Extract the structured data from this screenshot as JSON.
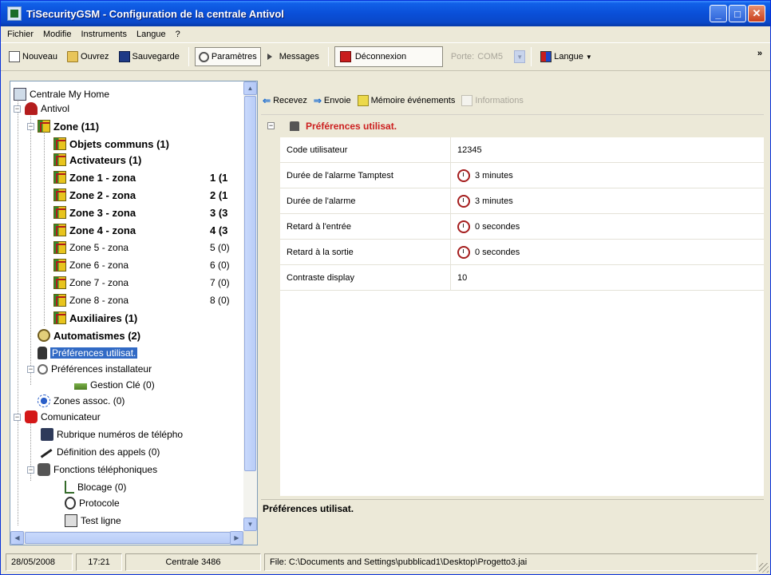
{
  "window": {
    "title": "TiSecurityGSM - Configuration de la centrale Antivol",
    "buttons": {
      "minimize": "_",
      "maximize": "□",
      "close": "✕"
    }
  },
  "menu": [
    "Fichier",
    "Modifie",
    "Instruments",
    "Langue",
    "?"
  ],
  "toolbar": {
    "new_label": "Nouveau",
    "open_label": "Ouvrez",
    "save_label": "Sauvegarde",
    "params_label": "Paramètres",
    "messages_label": "Messages",
    "disconnect_label": "Déconnexion",
    "port_label": "Porte:",
    "port_value": "COM5",
    "language_label": "Langue",
    "more_glyph": "»"
  },
  "tree": {
    "items": [
      {
        "label": "Centrale My Home"
      },
      {
        "label": "Antivol"
      },
      {
        "label": "Zone (11)"
      },
      {
        "label": "Objets communs (1)"
      },
      {
        "label": "Activateurs (1)"
      },
      {
        "label": "Zone 1 - zona",
        "count": "1 (1"
      },
      {
        "label": "Zone 2 - zona",
        "count": "2 (1"
      },
      {
        "label": "Zone 3 - zona",
        "count": "3 (3"
      },
      {
        "label": "Zone 4 - zona",
        "count": "4 (3"
      },
      {
        "label": "Zone 5 - zona",
        "count": "5 (0)"
      },
      {
        "label": "Zone 6 - zona",
        "count": "6 (0)"
      },
      {
        "label": "Zone 7 - zona",
        "count": "7 (0)"
      },
      {
        "label": "Zone 8 - zona",
        "count": "8 (0)"
      },
      {
        "label": "Auxiliaires (1)"
      },
      {
        "label": "Automatismes (2)"
      },
      {
        "label": "Préférences utilisat."
      },
      {
        "label": "Préférences installateur"
      },
      {
        "label": "Gestion Clé (0)"
      },
      {
        "label": "Zones assoc. (0)"
      },
      {
        "label": "Comunicateur"
      },
      {
        "label": "Rubrique numéros de télépho"
      },
      {
        "label": "Définition des appels (0)"
      },
      {
        "label": "Fonctions téléphoniques"
      },
      {
        "label": "Blocage (0)"
      },
      {
        "label": "Protocole"
      },
      {
        "label": "Test ligne"
      }
    ]
  },
  "right_toolbar": {
    "receive_label": "Recevez",
    "send_label": "Envoie",
    "events_label": "Mémoire événements",
    "info_label": "Informations"
  },
  "grid": {
    "header": "Préférences utilisat.",
    "rows": [
      {
        "name": "Code utilisateur",
        "value": "12345"
      },
      {
        "name": "Durée de l'alarme Tamptest",
        "value": "3 minutes"
      },
      {
        "name": "Durée de l'alarme",
        "value": "3 minutes"
      },
      {
        "name": "Retard à l'entrée",
        "value": "0 secondes"
      },
      {
        "name": "Retard à la sortie",
        "value": "0 secondes"
      },
      {
        "name": "Contraste display",
        "value": "10"
      }
    ]
  },
  "description": "Préférences utilisat.",
  "status": {
    "date": "28/05/2008",
    "time": "17:21",
    "central": "Centrale 3486",
    "file": "File: C:\\Documents and Settings\\pubblicad1\\Desktop\\Progetto3.jai"
  }
}
